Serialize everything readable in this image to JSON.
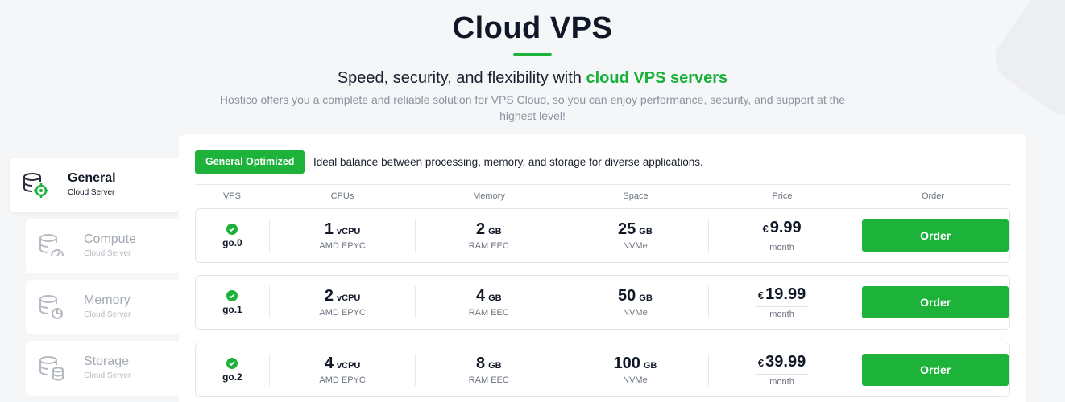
{
  "hero": {
    "title": "Cloud VPS",
    "subtitle_prefix": "Speed, security, and flexibility with ",
    "subtitle_accent": "cloud VPS servers",
    "description": "Hostico offers you a complete and reliable solution for VPS Cloud, so you can enjoy performance, security, and support at the highest level!"
  },
  "colors": {
    "accent": "#1db33b",
    "text": "#101828",
    "muted": "#6d7480"
  },
  "nav": [
    {
      "label": "General",
      "sub": "Cloud Server",
      "icon": "server-gear-icon",
      "active": true
    },
    {
      "label": "Compute",
      "sub": "Cloud Server",
      "icon": "server-gauge-icon",
      "active": false
    },
    {
      "label": "Memory",
      "sub": "Cloud Server",
      "icon": "server-pie-icon",
      "active": false
    },
    {
      "label": "Storage",
      "sub": "Cloud Server",
      "icon": "server-database-icon",
      "active": false
    }
  ],
  "panel": {
    "badge": "General Optimized",
    "badge_desc": "Ideal balance between processing, memory, and storage for diverse applications.",
    "headers": {
      "vps": "VPS",
      "cpu": "CPUs",
      "memory": "Memory",
      "space": "Space",
      "price": "Price",
      "order": "Order"
    },
    "plans": [
      {
        "name": "go.0",
        "cpu": "1",
        "cpu_unit": "vCPU",
        "cpu_sub": "AMD EPYC",
        "mem": "2",
        "mem_unit": "GB",
        "mem_sub": "RAM EEC",
        "space": "25",
        "space_unit": "GB",
        "space_sub": "NVMe",
        "currency": "€",
        "price": "9.99",
        "period": "month",
        "order": "Order"
      },
      {
        "name": "go.1",
        "cpu": "2",
        "cpu_unit": "vCPU",
        "cpu_sub": "AMD EPYC",
        "mem": "4",
        "mem_unit": "GB",
        "mem_sub": "RAM EEC",
        "space": "50",
        "space_unit": "GB",
        "space_sub": "NVMe",
        "currency": "€",
        "price": "19.99",
        "period": "month",
        "order": "Order"
      },
      {
        "name": "go.2",
        "cpu": "4",
        "cpu_unit": "vCPU",
        "cpu_sub": "AMD EPYC",
        "mem": "8",
        "mem_unit": "GB",
        "mem_sub": "RAM EEC",
        "space": "100",
        "space_unit": "GB",
        "space_sub": "NVMe",
        "currency": "€",
        "price": "39.99",
        "period": "month",
        "order": "Order"
      }
    ]
  }
}
